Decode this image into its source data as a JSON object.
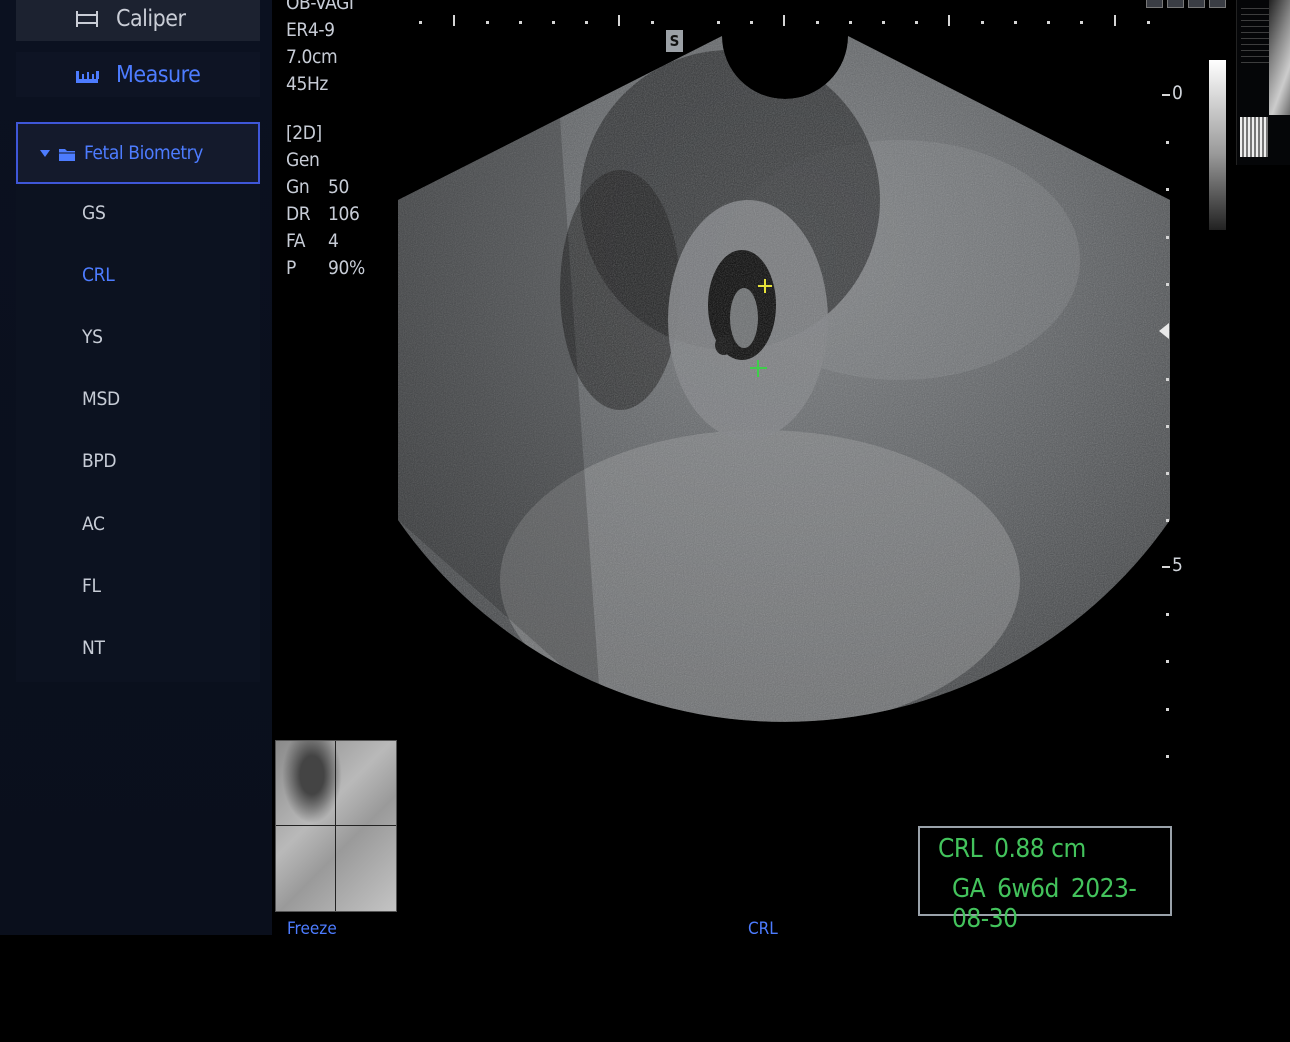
{
  "tools": {
    "caliper_label": "Caliper",
    "measure_label": "Measure"
  },
  "folder": {
    "label": "Fetal Biometry",
    "items": [
      {
        "label": "GS",
        "active": false
      },
      {
        "label": "CRL",
        "active": true
      },
      {
        "label": "YS",
        "active": false
      },
      {
        "label": "MSD",
        "active": false
      },
      {
        "label": "BPD",
        "active": false
      },
      {
        "label": "AC",
        "active": false
      },
      {
        "label": "FL",
        "active": false
      },
      {
        "label": "NT",
        "active": false
      }
    ]
  },
  "probe": {
    "preset": "OB-VAGI",
    "transducer": "ER4-9",
    "depth": "7.0cm",
    "frame_rate": "45Hz"
  },
  "imaging": {
    "mode": "[2D]",
    "preset_mode": "Gen",
    "params": [
      {
        "key": "Gn",
        "value": "50"
      },
      {
        "key": "DR",
        "value": "106"
      },
      {
        "key": "FA",
        "value": "4"
      },
      {
        "key": "P",
        "value": "90%"
      }
    ]
  },
  "scale": {
    "marker": "S",
    "depth_top": "0",
    "depth_mid": "5"
  },
  "result": {
    "crl_label": "CRL",
    "crl_value": "0.88 cm",
    "ga_label": "GA",
    "ga_value": "6w6d",
    "edd": "2023-08-30"
  },
  "status": {
    "freeze": "Freeze",
    "mode": "CRL"
  },
  "colors": {
    "accent": "#4d7cff",
    "result_text": "#43c35c",
    "caliper_start": "#e6e23a",
    "caliper_end": "#3ecf4a"
  }
}
